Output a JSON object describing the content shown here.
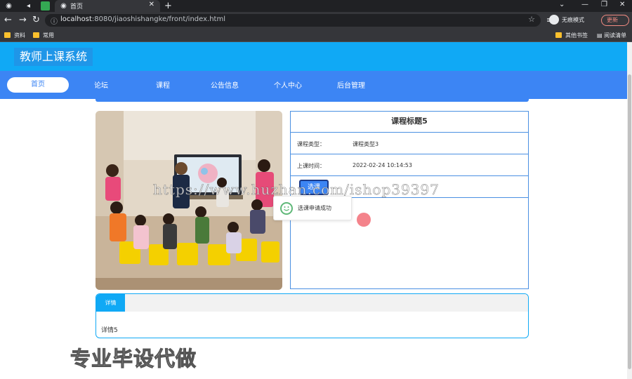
{
  "browser": {
    "tab_title": "首页",
    "url_host": "localhost",
    "url_rest": ":8080/jiaoshishangke/front/index.html",
    "incognito_label": "无痕模式",
    "update_label": "更新",
    "bookmarks": [
      "资料",
      "常用"
    ],
    "bookmarks_right": [
      "其他书签",
      "阅读清单"
    ]
  },
  "site": {
    "title": "教师上课系统",
    "nav": [
      "首页",
      "论坛",
      "课程",
      "公告信息",
      "个人中心",
      "后台管理"
    ]
  },
  "course": {
    "title": "课程标题5",
    "type_label": "课程类型：",
    "type_value": "课程类型3",
    "time_label": "上课时间：",
    "time_value": "2022-02-24 10:14:53",
    "select_button": "选课"
  },
  "toast": {
    "message": "选课申请成功"
  },
  "details": {
    "tab_label": "详情",
    "content": "详情5"
  },
  "overlay": {
    "watermark_url": "https://www.huzhan.com/ishop39397",
    "watermark_text": "专业毕设代做"
  },
  "colors": {
    "header": "#10a9f5",
    "nav": "#3c85f4",
    "border": "#4a90e2",
    "success": "#5fb878"
  }
}
